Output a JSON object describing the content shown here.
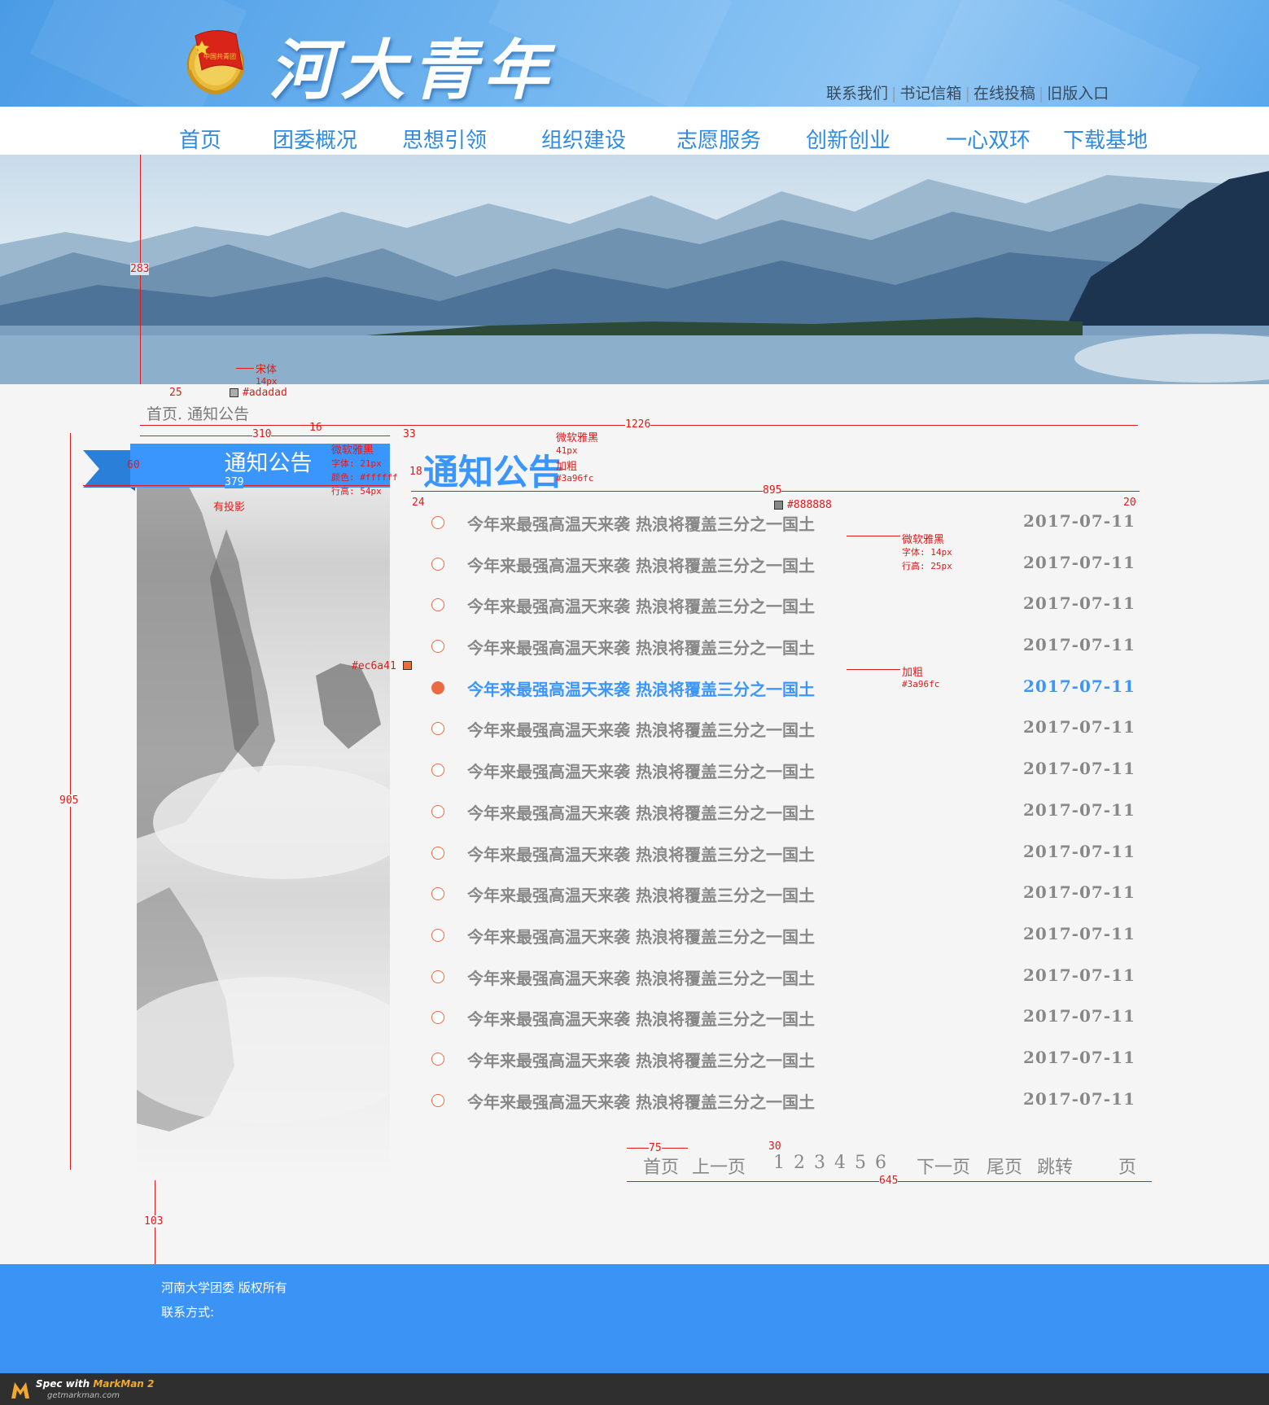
{
  "header": {
    "site_title": "河大青年",
    "top_links": [
      "联系我们",
      "书记信箱",
      "在线投稿",
      "旧版入口"
    ],
    "emblem_icon": "youth-league-emblem-icon"
  },
  "nav": {
    "items": [
      "首页",
      "团委概况",
      "思想引领",
      "组织建设",
      "志愿服务",
      "创新创业",
      "一心双环",
      "下载基地"
    ]
  },
  "breadcrumb": "首页. 通知公告",
  "sidebar": {
    "ribbon_label": "通知公告"
  },
  "main": {
    "title": "通知公告",
    "notices": [
      {
        "title": "今年来最强高温天来袭 热浪将覆盖三分之一国土",
        "date": "2017-07-11",
        "active": false
      },
      {
        "title": "今年来最强高温天来袭 热浪将覆盖三分之一国土",
        "date": "2017-07-11",
        "active": false
      },
      {
        "title": "今年来最强高温天来袭 热浪将覆盖三分之一国土",
        "date": "2017-07-11",
        "active": false
      },
      {
        "title": "今年来最强高温天来袭 热浪将覆盖三分之一国土",
        "date": "2017-07-11",
        "active": false
      },
      {
        "title": "今年来最强高温天来袭 热浪将覆盖三分之一国土",
        "date": "2017-07-11",
        "active": true
      },
      {
        "title": "今年来最强高温天来袭 热浪将覆盖三分之一国土",
        "date": "2017-07-11",
        "active": false
      },
      {
        "title": "今年来最强高温天来袭 热浪将覆盖三分之一国土",
        "date": "2017-07-11",
        "active": false
      },
      {
        "title": "今年来最强高温天来袭 热浪将覆盖三分之一国土",
        "date": "2017-07-11",
        "active": false
      },
      {
        "title": "今年来最强高温天来袭 热浪将覆盖三分之一国土",
        "date": "2017-07-11",
        "active": false
      },
      {
        "title": "今年来最强高温天来袭 热浪将覆盖三分之一国土",
        "date": "2017-07-11",
        "active": false
      },
      {
        "title": "今年来最强高温天来袭 热浪将覆盖三分之一国土",
        "date": "2017-07-11",
        "active": false
      },
      {
        "title": "今年来最强高温天来袭 热浪将覆盖三分之一国土",
        "date": "2017-07-11",
        "active": false
      },
      {
        "title": "今年来最强高温天来袭 热浪将覆盖三分之一国土",
        "date": "2017-07-11",
        "active": false
      },
      {
        "title": "今年来最强高温天来袭 热浪将覆盖三分之一国土",
        "date": "2017-07-11",
        "active": false
      },
      {
        "title": "今年来最强高温天来袭 热浪将覆盖三分之一国土",
        "date": "2017-07-11",
        "active": false
      }
    ]
  },
  "pager": {
    "first": "首页",
    "prev": "上一页",
    "pages": [
      "1",
      "2",
      "3",
      "4",
      "5",
      "6"
    ],
    "next": "下一页",
    "last": "尾页",
    "jump": "跳转",
    "page_unit": "页"
  },
  "footer": {
    "copyright": "河南大学团委  版权所有",
    "contact": "联系方式:"
  },
  "markman": {
    "prefix": "Spec with ",
    "brand": "MarkMan 2",
    "url": "getmarkman.com"
  },
  "colors": {
    "accent": "#3a96fc",
    "dot": "#ec6a41",
    "text_gray": "#888888",
    "crumb_gray": "#adadad",
    "footer_blue": "#3c93f6",
    "spec_red": "#e01b1b"
  },
  "spec_annotations": {
    "crumb": {
      "font": "宋体",
      "size": "14px",
      "color": "#adadad",
      "offset": "25"
    },
    "banner_height": "283",
    "ribbon": {
      "w310": "310",
      "w16": "16",
      "w379": "379",
      "h60": "60",
      "font": "微软雅黑",
      "size": "字体: 21px",
      "color": "颜色: #ffffff",
      "lh": "行高: 54px",
      "shadow": "有投影"
    },
    "content_width": "1226",
    "title_gap": "33",
    "title_spec": {
      "font": "微软雅黑",
      "size": "41px",
      "bold": "加粗",
      "color": "#3a96fc",
      "gap": "18"
    },
    "list_width": "895",
    "list_left": "24",
    "list_right": "20",
    "list_color": "#888888",
    "list_font": {
      "font": "微软雅黑",
      "size": "字体: 14px",
      "lh": "行高: 25px"
    },
    "dot_color": "#ec6a41",
    "hover": {
      "bold": "加粗",
      "color": "#3a96fc"
    },
    "sidebar_height": "905",
    "pager": {
      "w75": "75",
      "w30": "30",
      "w645": "645"
    },
    "footer_gap": "103"
  }
}
